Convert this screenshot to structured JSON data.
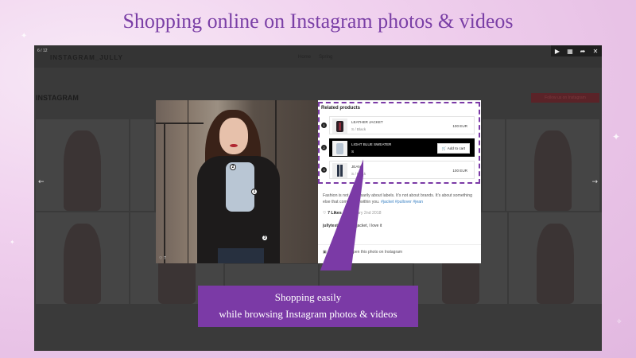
{
  "headline": "Shopping online on Instagram photos & videos",
  "background_page": {
    "brand": "INSTAGRAM_JULLY",
    "nav": [
      "Home",
      "Spring"
    ],
    "section_title": "INSTAGRAM",
    "follow_button": "Follow us on Instagram"
  },
  "lightbox": {
    "counter": "6 / 12",
    "controls": [
      {
        "name": "play-icon",
        "glyph": "▶"
      },
      {
        "name": "grid-icon",
        "glyph": "▦"
      },
      {
        "name": "share-icon",
        "glyph": "➦"
      },
      {
        "name": "close-icon",
        "glyph": "✕"
      }
    ],
    "prev_glyph": "←",
    "next_glyph": "→",
    "photo_likes": "♡ 7",
    "hotspots": [
      "1",
      "2",
      "3"
    ]
  },
  "panel": {
    "title": "Related products",
    "products": [
      {
        "num": "1",
        "name": "LEATHER JACKET",
        "variant": "S / Black",
        "price": "100 EUR",
        "active": false
      },
      {
        "num": "2",
        "name": "LIGHT BLUE SWEATER",
        "variant": "S",
        "price": "",
        "cart_label": "Add to cart",
        "active": true
      },
      {
        "num": "3",
        "name": "JEAN",
        "variant": "S / Black",
        "price": "100 EUR",
        "active": false
      }
    ],
    "caption_text": "Fashion is not necessarily about labels. It's not about brands. It's about something else that come from within you.",
    "caption_tags": "#jacket #pullover #jean",
    "likes": "7 Likes",
    "date": "February 2nd 2018",
    "comment_user": "jullytest123",
    "comment_text": "Great jacket, I love it",
    "open_link": "Click here to open this photo on Instagram"
  },
  "callout": {
    "line1": "Shopping easily",
    "line2": "while browsing Instagram photos & videos"
  },
  "colors": {
    "accent": "#7b3aa6",
    "headline": "#7a3fa6",
    "hashtag": "#3b82c4"
  }
}
